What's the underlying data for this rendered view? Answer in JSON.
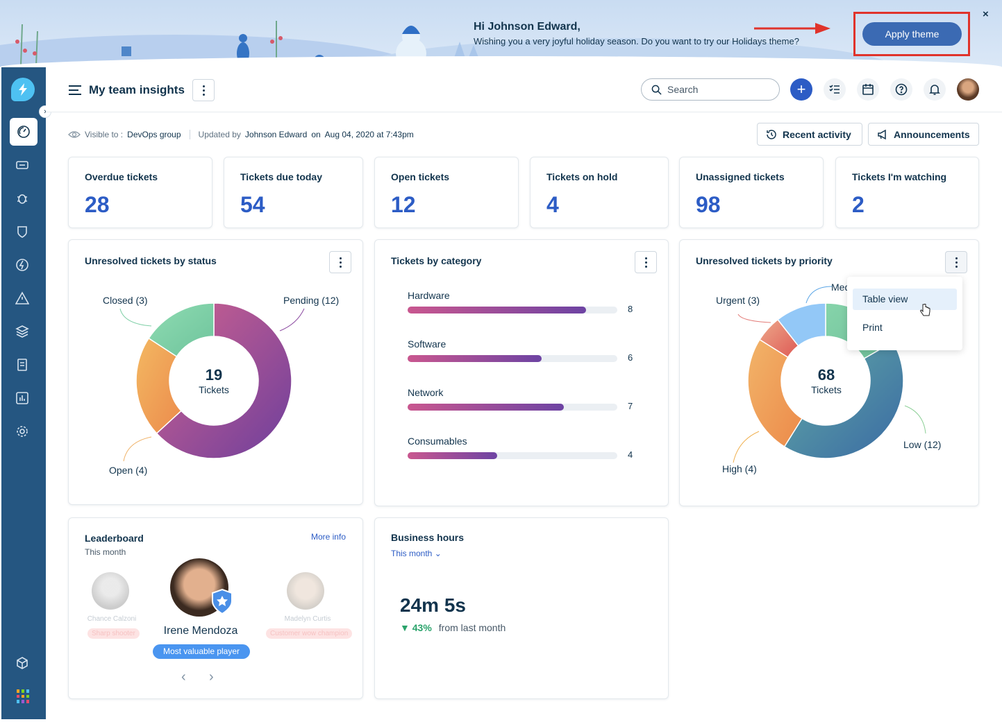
{
  "banner": {
    "greeting": "Hi Johnson Edward,",
    "message": "Wishing you a very joyful holiday season. Do you want to try our Holidays theme?",
    "apply_label": "Apply theme",
    "close_label": "×"
  },
  "header": {
    "title": "My team insights",
    "search_placeholder": "Search"
  },
  "sidebar": {
    "items": [
      "dashboard",
      "tickets",
      "problems",
      "changes",
      "releases",
      "alerts",
      "assets",
      "solutions",
      "reports",
      "admin"
    ]
  },
  "info": {
    "visible_label": "Visible to :",
    "visible_value": "DevOps group",
    "updated_label": "Updated by",
    "updated_by": "Johnson Edward",
    "updated_on_label": "on",
    "updated_on": "Aug 04, 2020 at 7:43pm",
    "recent_activity": "Recent activity",
    "announcements": "Announcements"
  },
  "stats": [
    {
      "label": "Overdue tickets",
      "value": "28"
    },
    {
      "label": "Tickets due today",
      "value": "54"
    },
    {
      "label": "Open tickets",
      "value": "12"
    },
    {
      "label": "Tickets on hold",
      "value": "4"
    },
    {
      "label": "Unassigned tickets",
      "value": "98"
    },
    {
      "label": "Tickets I'm watching",
      "value": "2"
    }
  ],
  "chart_data": [
    {
      "type": "pie",
      "title": "Unresolved tickets by status",
      "center_value": "19",
      "center_label": "Tickets",
      "slices": [
        {
          "label": "Pending (12)",
          "name": "Pending",
          "value": 12,
          "colors": [
            "#d0628f",
            "#6e3f9c"
          ]
        },
        {
          "label": "Open (4)",
          "name": "Open",
          "value": 4,
          "colors": [
            "#f3b862",
            "#ec8b4c"
          ]
        },
        {
          "label": "Closed (3)",
          "name": "Closed",
          "value": 3,
          "colors": [
            "#8fdcb2",
            "#6ec39c"
          ]
        }
      ]
    },
    {
      "type": "bar",
      "title": "Tickets by category",
      "categories": [
        "Hardware",
        "Software",
        "Network",
        "Consumables"
      ],
      "values": [
        8,
        6,
        7,
        4
      ]
    },
    {
      "type": "pie",
      "title": "Unresolved tickets by priority",
      "center_value": "68",
      "center_label": "Tickets",
      "slices": [
        {
          "label": "Med",
          "name": "Medium",
          "colors": [
            "#93c8f7",
            "#93c8f7"
          ]
        },
        {
          "label": "Low (12)",
          "name": "Low",
          "value": 12,
          "colors": [
            "#62aaa6",
            "#3a6aa3"
          ]
        },
        {
          "label": "High (4)",
          "name": "High",
          "value": 4,
          "colors": [
            "#f2b469",
            "#ec8a4a"
          ]
        },
        {
          "label": "Urgent (3)",
          "name": "Urgent",
          "value": 3,
          "colors": [
            "#eda88a",
            "#de5a55"
          ]
        }
      ],
      "menu": [
        "Table view",
        "Print"
      ]
    }
  ],
  "leaderboard": {
    "title": "Leaderboard",
    "subtitle": "This month",
    "more_info": "More info",
    "players": [
      {
        "name": "Chance Calzoni",
        "badge": "Sharp shooter"
      },
      {
        "name": "Irene Mendoza",
        "badge": "Most valuable player"
      },
      {
        "name": "Madelyn Curtis",
        "badge": "Customer wow champion"
      }
    ]
  },
  "business_hours": {
    "title": "Business hours",
    "period": "This month",
    "value": "24m 5s",
    "change": "43%",
    "change_label": "from last month",
    "trend_color": "#2aa36b"
  }
}
